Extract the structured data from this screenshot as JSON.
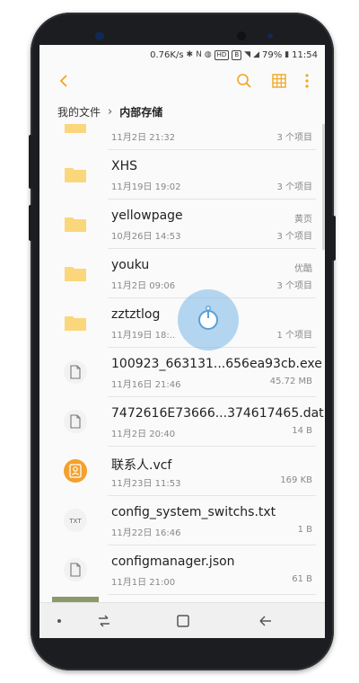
{
  "status_bar": {
    "network_speed": "0.76K/s",
    "battery": "79%",
    "time": "11:54",
    "badge_hd": "HD",
    "badge_b": "B"
  },
  "breadcrumb": {
    "root": "我的文件",
    "current": "内部存储"
  },
  "files": [
    {
      "type": "folder",
      "name": "",
      "date": "11月2日 21:32",
      "source": "",
      "meta": "3 个项目"
    },
    {
      "type": "folder",
      "name": "XHS",
      "date": "11月19日 19:02",
      "source": "",
      "meta": "3 个项目"
    },
    {
      "type": "folder",
      "name": "yellowpage",
      "date": "10月26日 14:53",
      "source": "黄页",
      "meta": "3 个项目"
    },
    {
      "type": "folder",
      "name": "youku",
      "date": "11月2日 09:06",
      "source": "优酷",
      "meta": "3 个项目"
    },
    {
      "type": "folder",
      "name": "zztztlog",
      "date": "11月19日 18:..",
      "source": "",
      "meta": "1 个项目"
    },
    {
      "type": "file",
      "name": "100923_663131...656ea93cb.exe",
      "date": "11月16日 21:46",
      "source": "",
      "meta": "45.72 MB"
    },
    {
      "type": "file",
      "name": "7472616E73666...374617465.dat",
      "date": "11月2日 20:40",
      "source": "",
      "meta": "14 B"
    },
    {
      "type": "contact",
      "name": "联系人.vcf",
      "date": "11月23日 11:53",
      "source": "",
      "meta": "169 KB"
    },
    {
      "type": "txt",
      "name": "config_system_switchs.txt",
      "date": "11月22日 16:46",
      "source": "",
      "meta": "1 B",
      "icon_text": "TXT"
    },
    {
      "type": "file",
      "name": "configmanager.json",
      "date": "11月1日 21:00",
      "source": "",
      "meta": "61 B"
    }
  ],
  "colors": {
    "accent": "#f0a623",
    "folder": "#fbd77c",
    "contact": "#f4a12d",
    "overlay": "#78b6e6"
  }
}
